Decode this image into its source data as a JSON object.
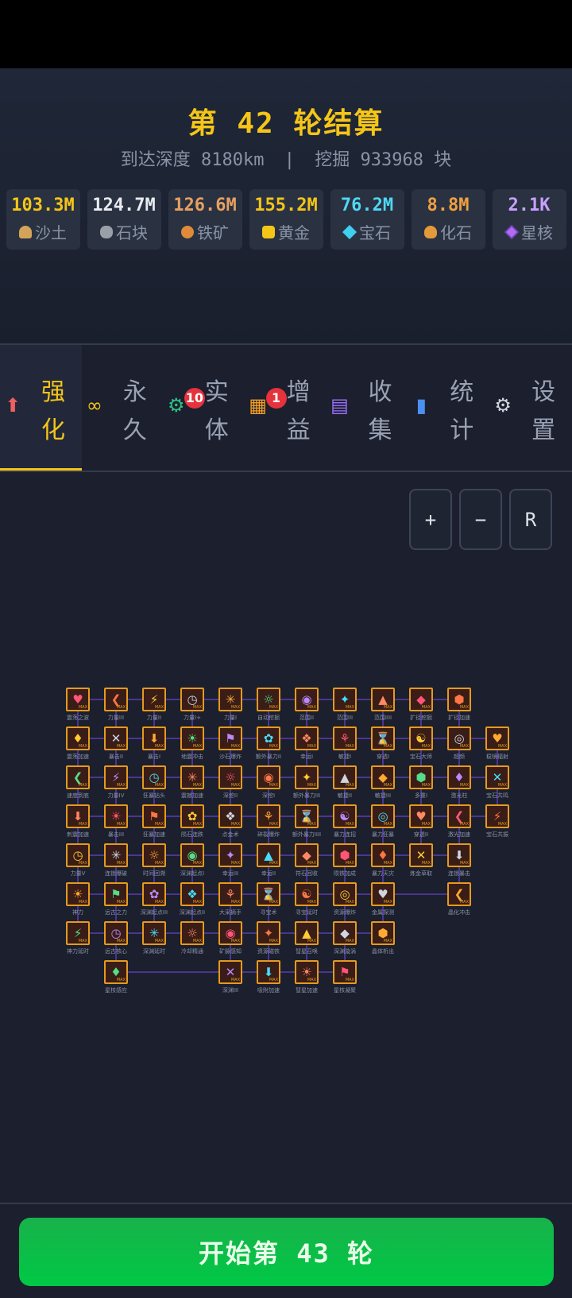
{
  "header": {
    "title": "第 42 轮结算",
    "depth_label": "到达深度",
    "depth_value": "8180km",
    "dig_label": "挖掘",
    "dig_value": "933968 块",
    "separator": "|"
  },
  "resources": [
    {
      "value": "103.3M",
      "label": "沙土",
      "color": "#f5c518",
      "icon": "sand-icon"
    },
    {
      "value": "124.7M",
      "label": "石块",
      "color": "#e8ebf0",
      "icon": "stone-icon"
    },
    {
      "value": "126.6M",
      "label": "铁矿",
      "color": "#e8a060",
      "icon": "iron-ore-icon"
    },
    {
      "value": "155.2M",
      "label": "黄金",
      "color": "#f5c518",
      "icon": "gold-icon"
    },
    {
      "value": "76.2M",
      "label": "宝石",
      "color": "#4fd8f5",
      "icon": "gem-icon"
    },
    {
      "value": "8.8M",
      "label": "化石",
      "color": "#f0a040",
      "icon": "fossil-icon"
    },
    {
      "value": "2.1K",
      "label": "星核",
      "color": "#c8a0ff",
      "icon": "star-core-icon"
    }
  ],
  "tabs": [
    {
      "label": "强化",
      "icon": "up-arrow-icon",
      "active": true,
      "badge": ""
    },
    {
      "label": "永久",
      "icon": "infinity-icon",
      "active": false,
      "badge": ""
    },
    {
      "label": "实体",
      "icon": "gear-icon",
      "active": false,
      "badge": "10"
    },
    {
      "label": "增益",
      "icon": "chest-icon",
      "active": false,
      "badge": "1"
    },
    {
      "label": "收集",
      "icon": "list-icon",
      "active": false,
      "badge": ""
    },
    {
      "label": "统计",
      "icon": "bar-chart-icon",
      "active": false,
      "badge": ""
    },
    {
      "label": "设置",
      "icon": "gear-settings-icon",
      "active": false,
      "badge": ""
    }
  ],
  "zoom": {
    "plus": "+",
    "minus": "−",
    "reset": "R"
  },
  "tree": {
    "max_tag": "MAX",
    "rows": [
      [
        "震荡之波",
        "力量III",
        "力量II",
        "力量I+",
        "力量I",
        "自动挖掘",
        "范围II",
        "范围III",
        "范围IIII",
        "扩径挖掘",
        "扩径加速"
      ],
      [
        "震荡加速",
        "暴击II",
        "暴击I",
        "地震冲击",
        "沙石爆炸",
        "额外暴力II",
        "幸运I",
        "敏捷I",
        "穿透I",
        "宝石大师",
        "超频",
        "稳镜辐射"
      ],
      [
        "速度到底",
        "力量IV",
        "狂暴钻头",
        "震撼加速",
        "深挖II",
        "深挖I",
        "额外暴力III",
        "敏捷II",
        "敏捷III",
        "多重I",
        "激光柱",
        "宝石共鸣"
      ],
      [
        "刺震加速",
        "暴击III",
        "狂暴加速",
        "陨石连跌",
        "点金术",
        "碎裂爆炸",
        "额外暴力IIII",
        "暴力连招",
        "暴力狂暴",
        "穿透II",
        "激光加速",
        "宝石共振"
      ],
      [
        "力量V",
        "连锁爆破",
        "时间回溯",
        "深渊起点I",
        "幸运III",
        "幸运II",
        "符石回收",
        "陨铁加成",
        "暴力天灾",
        "炼金草取",
        "连锁暴击"
      ],
      [
        "神力",
        "远古之力",
        "深渊起点III",
        "深渊起点II",
        "大采摘手",
        "寻宝术",
        "寻宝延时",
        "资源爆炸",
        "金属探测",
        "晶化冲击"
      ],
      [
        "神力延时",
        "远古核心",
        "深渊延时",
        "冷却精通",
        "矿脉感知",
        "资源磁铁",
        "彗星召唤",
        "深渊漩涡",
        "晶体析出"
      ],
      [
        "星核感应",
        "深渊III",
        "吸附加速",
        "彗星加速",
        "星核凝聚"
      ]
    ]
  },
  "start_button": "开始第 43 轮"
}
